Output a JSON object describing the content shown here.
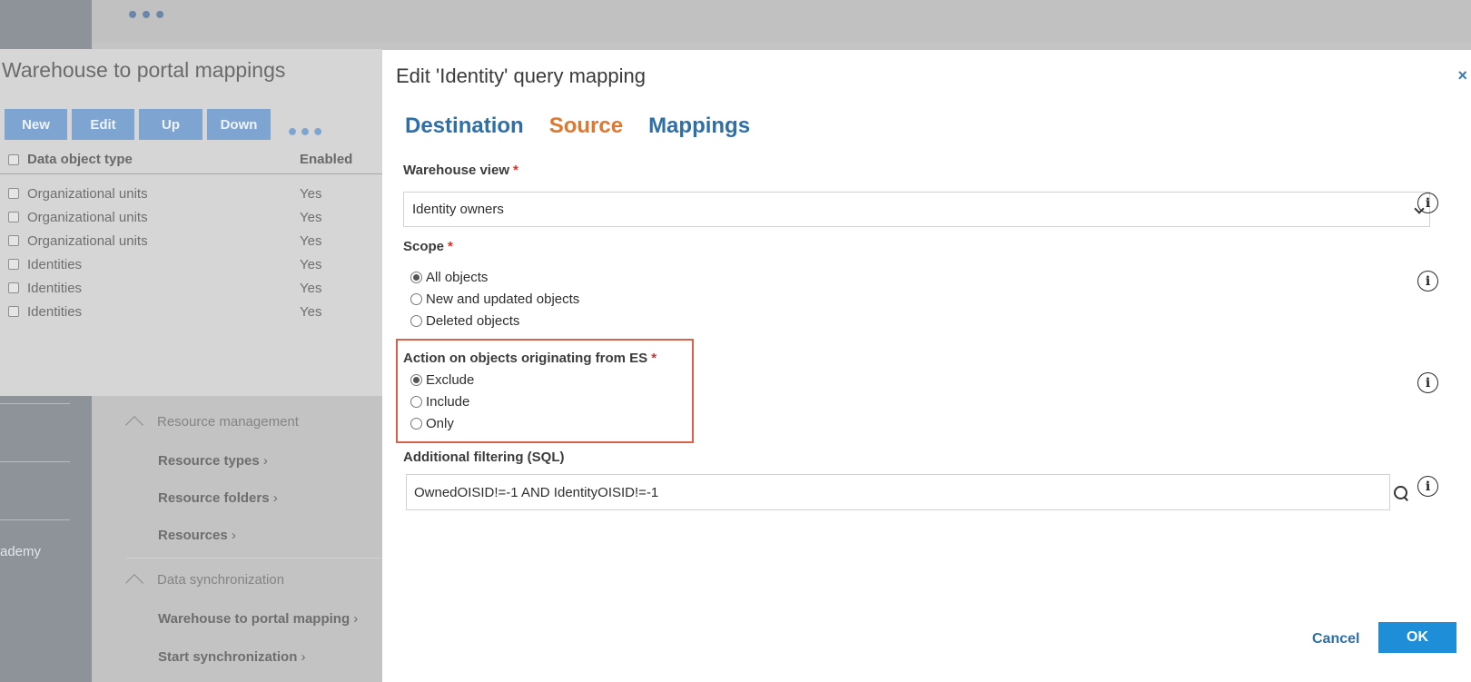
{
  "background": {
    "top_dots": "•••",
    "panel_title": "Warehouse to portal mappings",
    "toolbar": {
      "new_label": "New",
      "edit_label": "Edit",
      "up_label": "Up",
      "down_label": "Down",
      "more_label": "•••"
    },
    "table": {
      "headers": [
        "Data object type",
        "Enabled"
      ],
      "rows": [
        {
          "type": "Organizational units",
          "enabled": "Yes"
        },
        {
          "type": "Organizational units",
          "enabled": "Yes"
        },
        {
          "type": "Organizational units",
          "enabled": "Yes"
        },
        {
          "type": "Identities",
          "enabled": "Yes"
        },
        {
          "type": "Identities",
          "enabled": "Yes"
        },
        {
          "type": "Identities",
          "enabled": "Yes"
        }
      ]
    },
    "nav": {
      "section1": "Resource management",
      "section1_links": [
        "Resource types",
        "Resource folders",
        "Resources"
      ],
      "section2": "Data synchronization",
      "section2_links": [
        "Warehouse to portal mapping",
        "Start synchronization"
      ]
    },
    "rail_text": "ademy"
  },
  "dialog": {
    "title": "Edit 'Identity' query mapping",
    "close_label": "×",
    "tabs": [
      {
        "label": "Destination",
        "active": false
      },
      {
        "label": "Source",
        "active": true
      },
      {
        "label": "Mappings",
        "active": false
      }
    ],
    "warehouse_view": {
      "label": "Warehouse view",
      "required_mark": "*",
      "value": "Identity owners"
    },
    "scope": {
      "label": "Scope",
      "required_mark": "*",
      "options": [
        "All objects",
        "New and updated objects",
        "Deleted objects"
      ],
      "selected": "All objects"
    },
    "action_es": {
      "label": "Action on objects originating from ES",
      "required_mark": "*",
      "options": [
        "Exclude",
        "Include",
        "Only"
      ],
      "selected": "Exclude"
    },
    "sql_filter": {
      "label": "Additional filtering (SQL)",
      "value": "OwnedOISID!=-1 AND IdentityOISID!=-1"
    },
    "cancel_label": "Cancel",
    "ok_label": "OK",
    "colors": {
      "active_tab": "#e0772e",
      "tab": "#2f6fa8",
      "ok_button": "#1f8ed8",
      "highlight_border": "#d9624a",
      "required": "#d0342c"
    }
  }
}
